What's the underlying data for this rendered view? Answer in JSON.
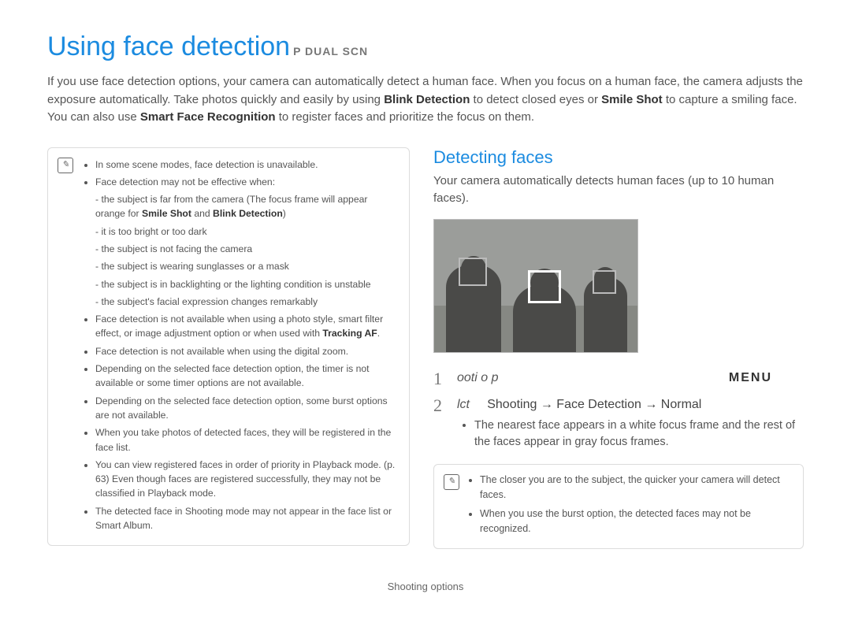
{
  "header": {
    "title": "Using face detection",
    "mode_icons": "P  DUAL  SCN"
  },
  "intro": {
    "part1": "If you use face detection options, your camera can automatically detect a human face. When you focus on a human face, the camera adjusts the exposure automatically. Take photos quickly and easily by using ",
    "bold1": "Blink Detection",
    "part2": " to detect closed eyes or ",
    "bold2": "Smile Shot",
    "part3": " to capture a smiling face. You can also use ",
    "bold3": "Smart Face Recognition",
    "part4": " to register faces and prioritize the focus on them."
  },
  "notes_left": {
    "items": [
      "In some scene modes, face detection is unavailable.",
      "Face detection may not be effective when:"
    ],
    "sub_items_a": "the subject is far from the camera (The focus frame will appear orange for ",
    "sub_items_a_b1": "Smile Shot",
    "sub_items_a_mid": " and ",
    "sub_items_a_b2": "Blink Detection",
    "sub_items_a_end": ")",
    "sub_items": [
      "it is too bright or too dark",
      "the subject is not facing the camera",
      "the subject is wearing sunglasses or a mask",
      "the subject is in backlighting or the lighting condition is unstable",
      "the subject's facial expression changes remarkably"
    ],
    "items2_a": "Face detection is not available when using a photo style, smart filter effect, or image adjustment option or when used with ",
    "items2_a_b": "Tracking AF",
    "items2_a_end": ".",
    "items2": [
      "Face detection is not available when using the digital zoom.",
      "Depending on the selected face detection option, the timer is not available or some timer options are not available.",
      "Depending on the selected face detection option, some burst options are not available.",
      "When you take photos of detected faces, they will be registered in the face list.",
      "You can view registered faces in order of priority in Playback mode. (p. 63) Even though faces are registered successfully, they may not be classified in Playback mode.",
      "The detected face in Shooting mode may not appear in the face list or Smart Album."
    ]
  },
  "right": {
    "section_title": "Detecting faces",
    "section_desc": "Your camera automatically detects human faces (up to 10 human faces).",
    "step1_label": "ooti o p",
    "step1_menu": "MENU",
    "step2_prefix": "lct",
    "step2_body": "Shooting → Face Detection → Normal",
    "step2_sub": "The nearest face appears in a white focus frame and the rest of the faces appear in gray focus frames.",
    "tips": [
      "The closer you are to the subject, the quicker your camera will detect faces.",
      "When you use the burst option, the detected faces may not be recognized."
    ]
  },
  "footer": "Shooting options"
}
